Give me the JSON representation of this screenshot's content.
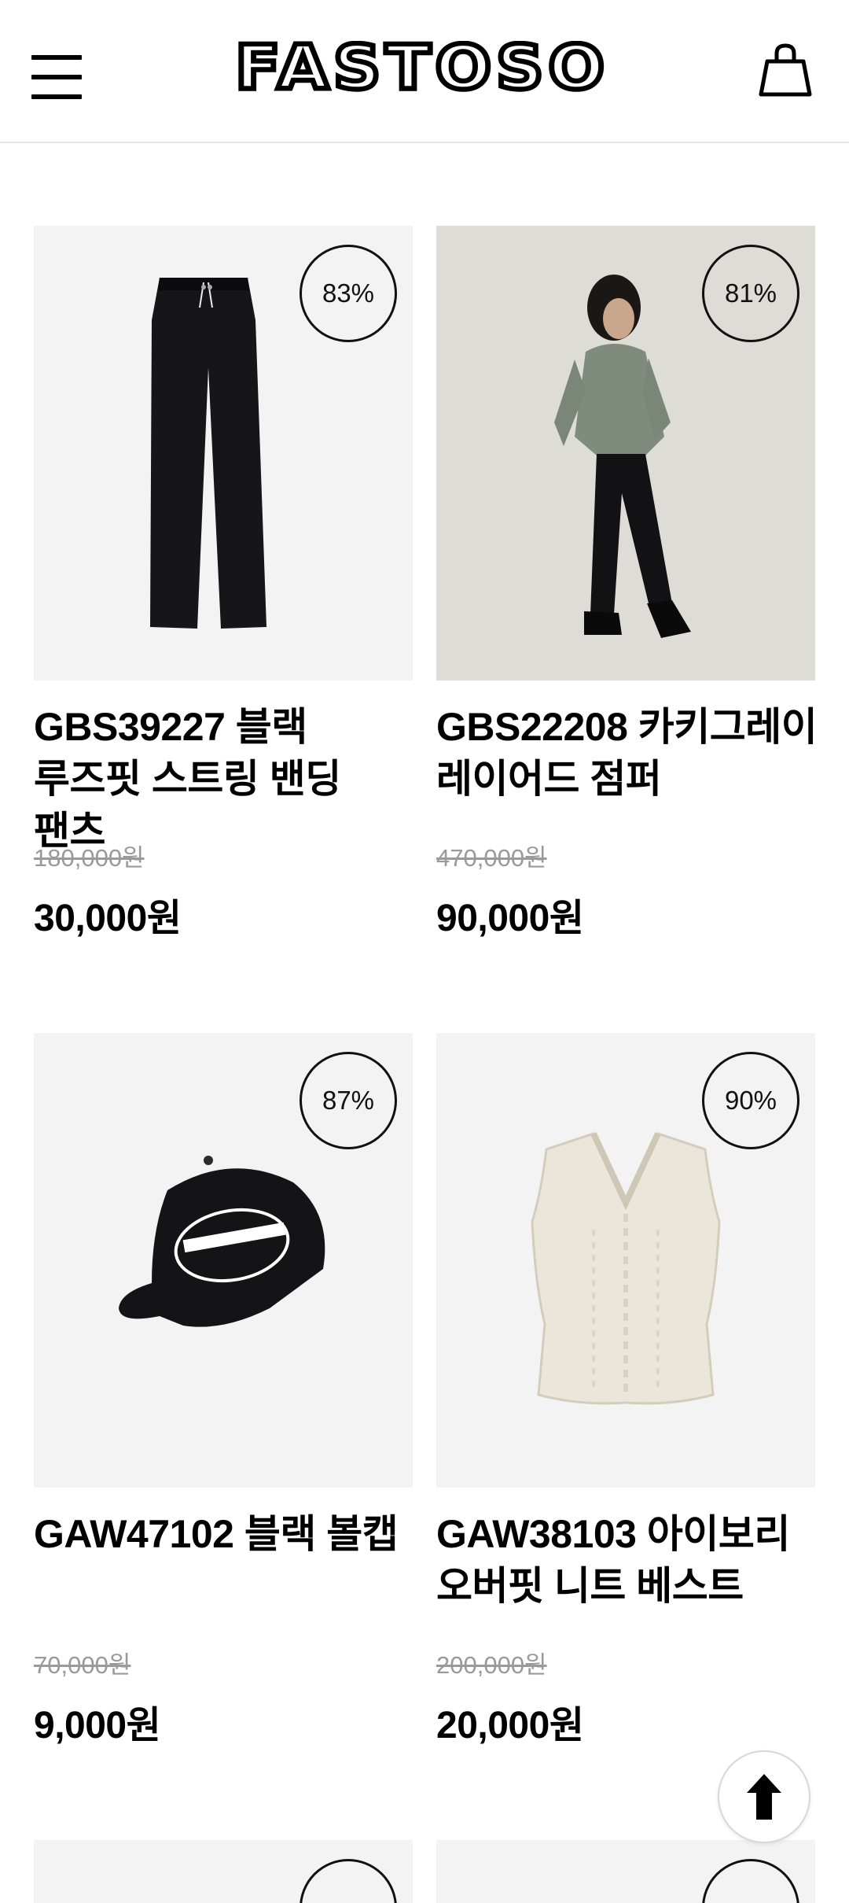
{
  "header": {
    "brand": "FASTOSO",
    "menu_icon": "hamburger-menu-icon",
    "cart_icon": "shopping-bag-icon"
  },
  "products": [
    {
      "title": "GBS39227 블랙 루즈핏 스트링 밴딩 팬츠",
      "discount": "83%",
      "original_price": "180,000원",
      "sale_price": "30,000원",
      "image": "black-pants"
    },
    {
      "title": "GBS22208 카키그레이 레이어드 점퍼",
      "discount": "81%",
      "original_price": "470,000원",
      "sale_price": "90,000원",
      "image": "model-khaki-jumper"
    },
    {
      "title": "GAW47102 블랙 볼캡",
      "discount": "87%",
      "original_price": "70,000원",
      "sale_price": "9,000원",
      "image": "black-ball-cap"
    },
    {
      "title": "GAW38103 아이보리 오버핏 니트 베스트",
      "discount": "90%",
      "original_price": "200,000원",
      "sale_price": "20,000원",
      "image": "ivory-knit-vest"
    }
  ],
  "scroll_top_icon": "arrow-up-icon",
  "colors": {
    "accent": "#000000",
    "muted_price": "#9a9a9a",
    "image_bg": "#f3f3f3"
  }
}
